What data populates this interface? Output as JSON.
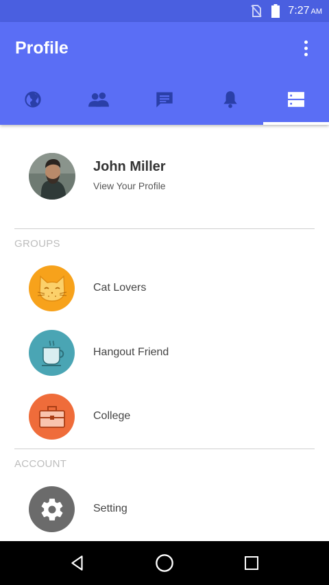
{
  "status_bar": {
    "time": "7:27",
    "ampm": "AM",
    "icons": [
      "no-sim-icon",
      "battery-icon"
    ]
  },
  "app_bar": {
    "title": "Profile",
    "overflow_icon": "more-vert-icon",
    "tabs": [
      {
        "icon": "globe-icon",
        "selected": false
      },
      {
        "icon": "people-icon",
        "selected": false
      },
      {
        "icon": "chat-icon",
        "selected": false
      },
      {
        "icon": "bell-icon",
        "selected": false
      },
      {
        "icon": "profile-card-icon",
        "selected": true
      }
    ],
    "colors": {
      "primary": "#5a6ef5",
      "status_bar": "#4a5fe0"
    }
  },
  "profile": {
    "name": "John Miller",
    "subtitle": "View Your Profile"
  },
  "groups": {
    "header": "GROUPS",
    "items": [
      {
        "label": "Cat Lovers",
        "icon": "cat-icon",
        "color": "#f7a21b"
      },
      {
        "label": "Hangout Friend",
        "icon": "coffee-cup-icon",
        "color": "#4aa5b4"
      },
      {
        "label": "College",
        "icon": "briefcase-icon",
        "color": "#ef6c3a"
      }
    ]
  },
  "account": {
    "header": "ACCOUNT",
    "items": [
      {
        "label": "Setting",
        "icon": "gear-icon",
        "color": "#6b6b6b"
      }
    ]
  },
  "nav_bar": {
    "buttons": [
      "back-icon",
      "home-icon",
      "recents-icon"
    ]
  }
}
